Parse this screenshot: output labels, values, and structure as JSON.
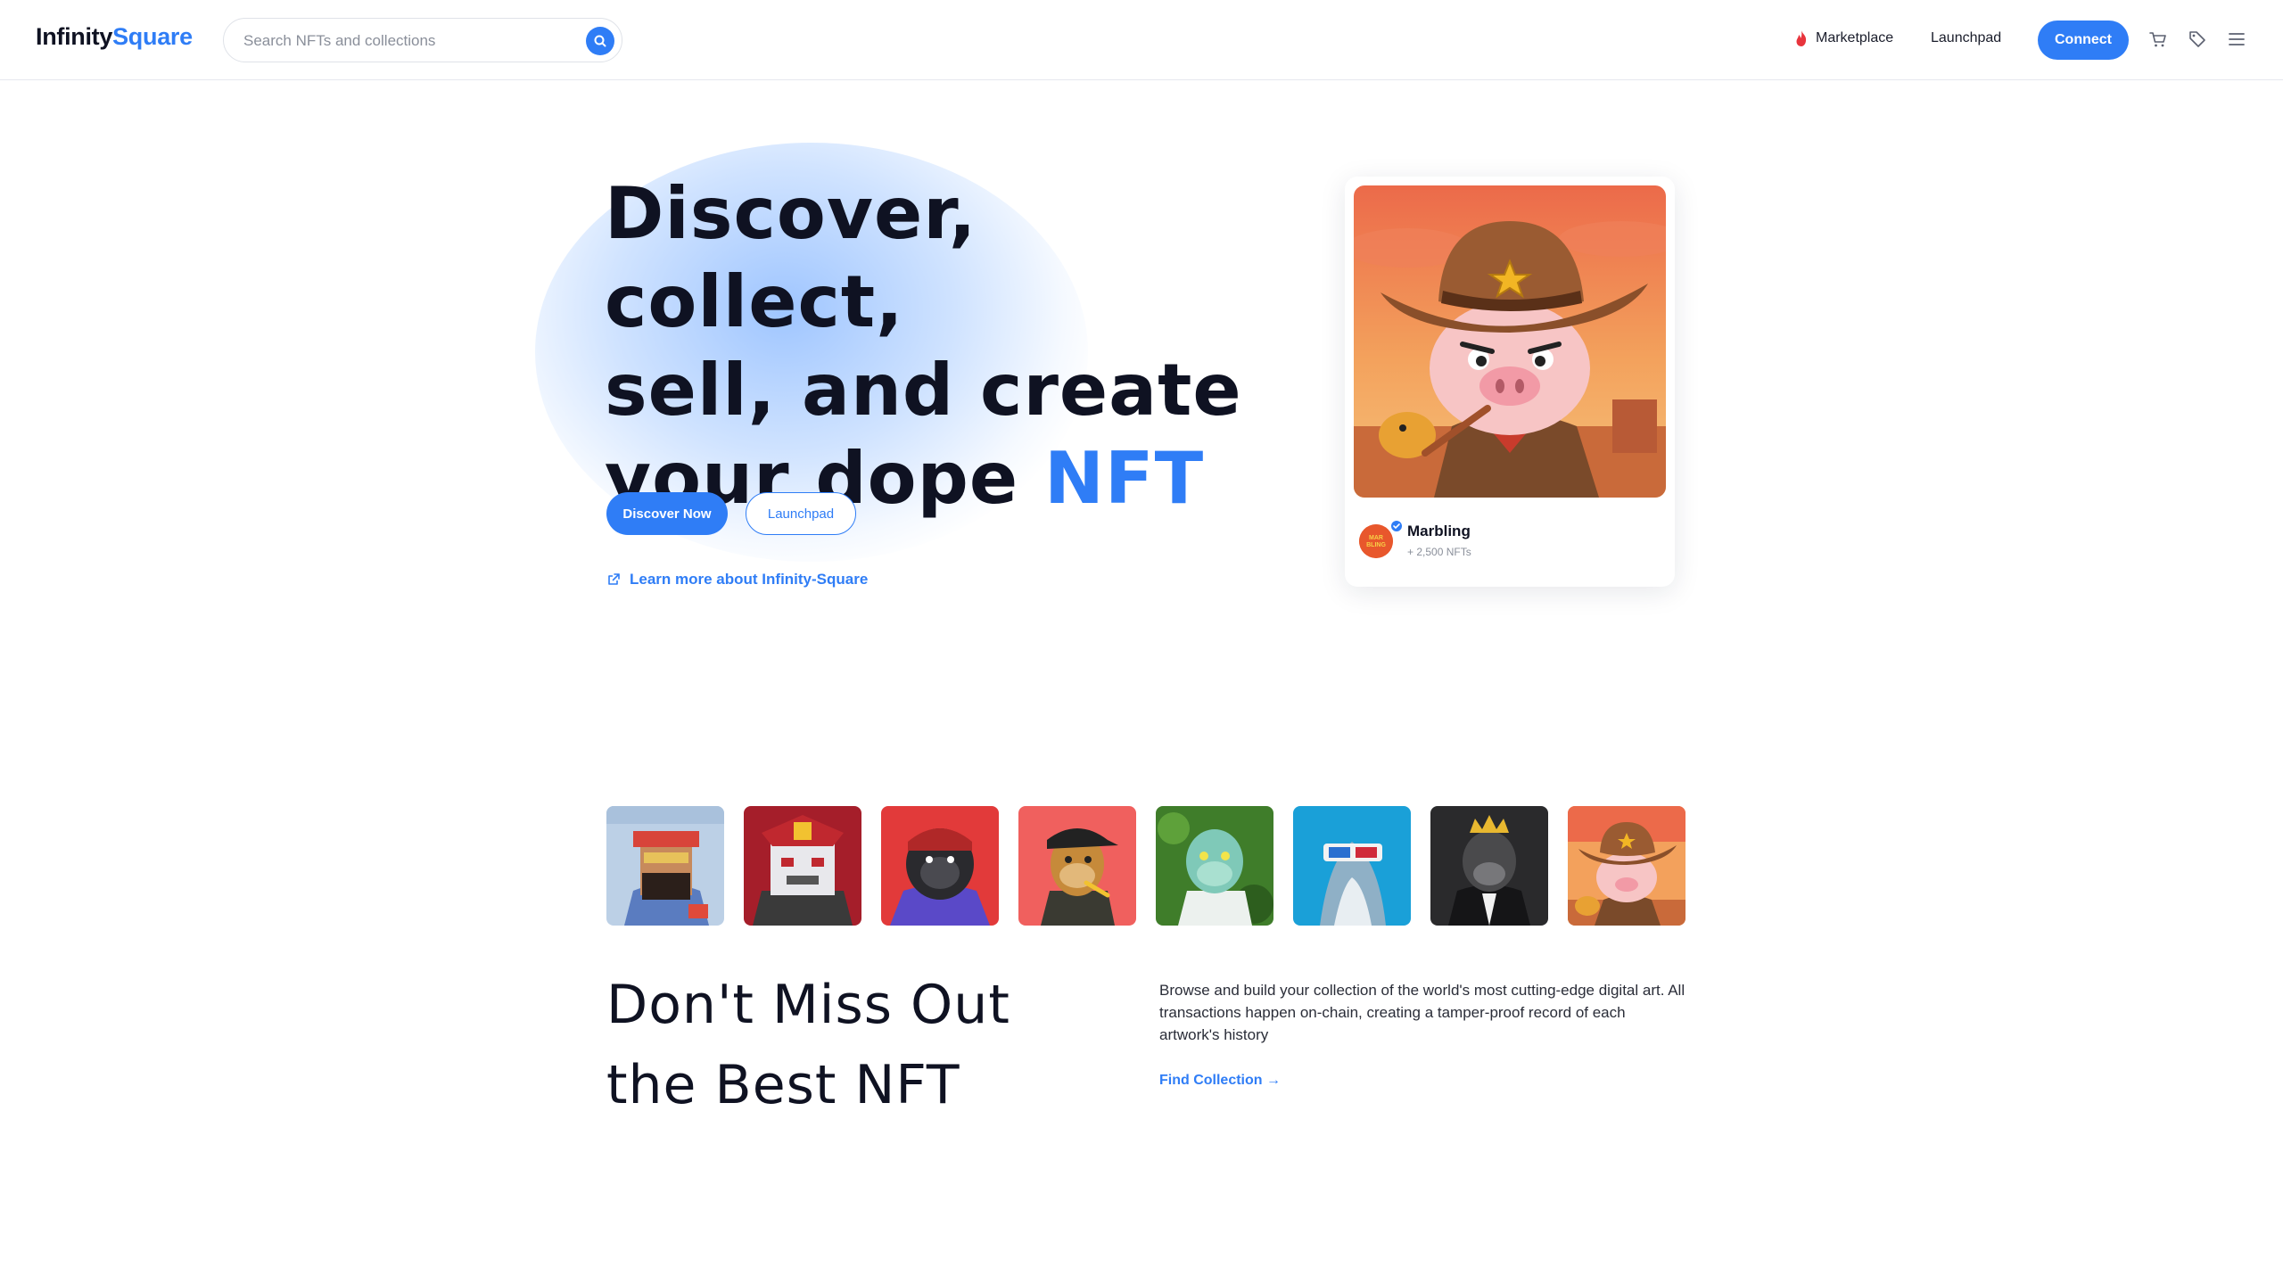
{
  "header": {
    "logo_part1": "Infinity",
    "logo_part2": "Square",
    "search_placeholder": "Search NFTs and collections",
    "nav": {
      "marketplace": "Marketplace",
      "launchpad": "Launchpad"
    },
    "connect_label": "Connect",
    "icons": [
      "cart-icon",
      "tag-icon",
      "menu-icon"
    ]
  },
  "hero": {
    "title_line1": "Discover, collect,",
    "title_line2": "sell, and create",
    "title_line3_prefix": "your dope ",
    "title_line3_accent": "NFT",
    "primary_button": "Discover Now",
    "secondary_button": "Launchpad",
    "learn_more": "Learn more about Infinity-Square"
  },
  "featured": {
    "collection_name": "Marbling",
    "item_count": "+ 2,500 NFTs",
    "avatar_text": "MAR BLING"
  },
  "thumbnails": [
    {
      "name": "pixel-man-nft"
    },
    {
      "name": "samurai-robot-nft"
    },
    {
      "name": "gorilla-nft"
    },
    {
      "name": "ape-cap-nft"
    },
    {
      "name": "zombie-ape-nft"
    },
    {
      "name": "shark-nft"
    },
    {
      "name": "king-ape-nft"
    },
    {
      "name": "cowboy-pig-nft"
    }
  ],
  "section": {
    "title_line1": "Don't Miss Out",
    "title_line2": "the Best NFT",
    "description": "Browse and build your collection of the world's most cutting-edge digital art. All transactions happen on-chain, creating a tamper-proof record of each artwork's history",
    "link": "Find Collection →"
  },
  "colors": {
    "accent": "#2f7df6",
    "text": "#0f1222"
  }
}
